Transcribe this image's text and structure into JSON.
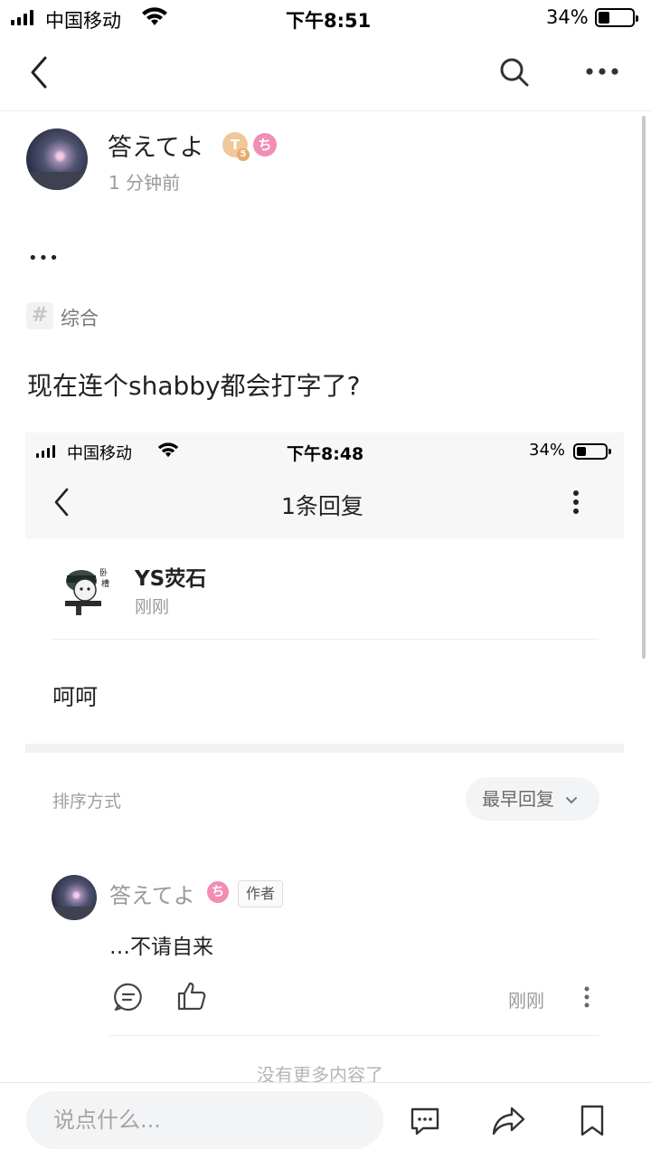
{
  "status_bar": {
    "carrier": "中国移动",
    "time": "下午8:51",
    "battery": "34%",
    "battery_level": 0.34
  },
  "post": {
    "author": "答えてよ",
    "time_ago": "1 分钟前",
    "content_dots": "•••",
    "tag": "综合",
    "title": "现在连个shabby都会打字了?",
    "badge_level_letter": "T",
    "badge_level_num": "5"
  },
  "embedded": {
    "status_bar": {
      "carrier": "中国移动",
      "time": "下午8:48",
      "battery": "34%",
      "battery_level": 0.34
    },
    "header_title": "1条回复",
    "reply_author": "YS荧石",
    "reply_time": "刚刚",
    "reply_text": "呵呵",
    "sort_label": "排序方式",
    "sort_value": "最早回复",
    "comment": {
      "author": "答えてよ",
      "author_tag": "作者",
      "text": "…不请自来",
      "time": "刚刚"
    },
    "no_more": "没有更多内容了"
  },
  "bottom_bar": {
    "input_placeholder": "说点什么..."
  },
  "icons": {
    "back": "back-icon",
    "search": "search-icon",
    "more": "more-icon",
    "hash": "hash-icon",
    "comment": "comment-icon",
    "like": "like-icon",
    "share": "share-icon",
    "bookmark": "bookmark-icon"
  },
  "colors": {
    "badge_gold": "#f1c79b",
    "badge_pink": "#f28db3",
    "muted_text": "#9a9a9a"
  }
}
